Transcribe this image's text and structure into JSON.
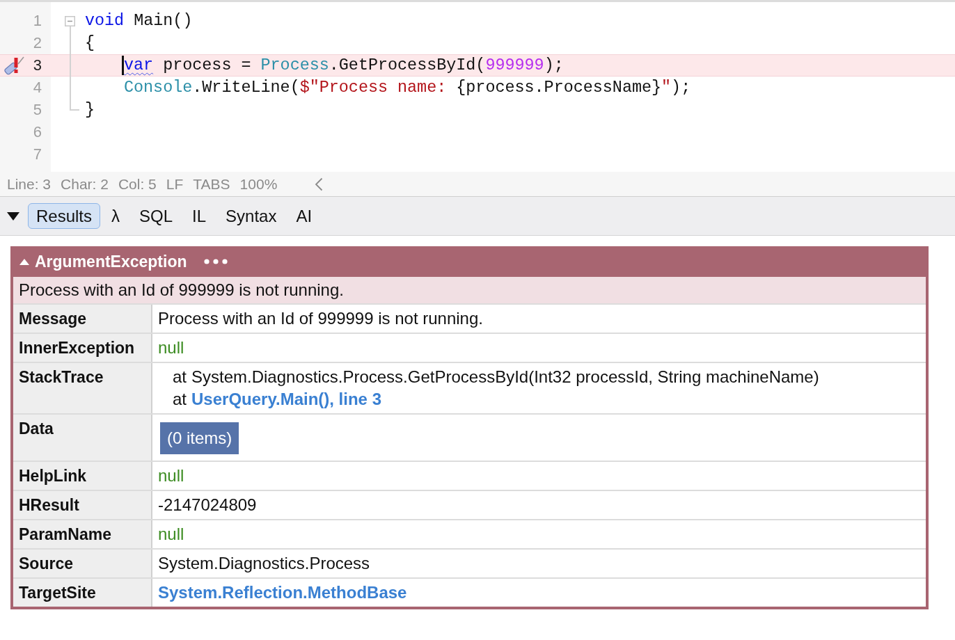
{
  "editor": {
    "fold_expanded": true,
    "lines": [
      {
        "number": "1",
        "current": false,
        "error": false,
        "tokens": [
          {
            "text": "void",
            "kind": "keyword",
            "squiggle": false
          },
          {
            "text": " Main()",
            "kind": "plain",
            "squiggle": false
          }
        ]
      },
      {
        "number": "2",
        "current": false,
        "error": false,
        "tokens": [
          {
            "text": "{",
            "kind": "plain",
            "squiggle": false
          }
        ],
        "children": [
          {
            "number": "3",
            "current": true,
            "error": true,
            "tokens": [
              {
                "text": "var",
                "kind": "keyword",
                "squiggle": true
              },
              {
                "text": " process = ",
                "kind": "plain",
                "squiggle": false
              },
              {
                "text": "Process",
                "kind": "type",
                "squiggle": false
              },
              {
                "text": ".GetProcessById(",
                "kind": "plain",
                "squiggle": false
              },
              {
                "text": "999999",
                "kind": "number",
                "squiggle": false
              },
              {
                "text": ");",
                "kind": "plain",
                "squiggle": false
              }
            ]
          },
          {
            "number": "4",
            "current": false,
            "error": false,
            "tokens": [
              {
                "text": "Console",
                "kind": "type",
                "squiggle": false
              },
              {
                "text": ".WriteLine(",
                "kind": "plain",
                "squiggle": false
              },
              {
                "text": "$\"Process name: ",
                "kind": "string",
                "squiggle": false
              },
              {
                "text": "{process.ProcessName}",
                "kind": "plain",
                "squiggle": false
              },
              {
                "text": "\"",
                "kind": "string",
                "squiggle": false
              },
              {
                "text": ");",
                "kind": "plain",
                "squiggle": false
              }
            ]
          }
        ]
      },
      {
        "number": "5",
        "current": false,
        "error": false,
        "tokens": [
          {
            "text": "}",
            "kind": "plain",
            "squiggle": false
          }
        ]
      },
      {
        "number": "6",
        "current": false,
        "error": false
      },
      {
        "number": "7",
        "current": false,
        "error": false
      }
    ]
  },
  "status_bar": {
    "items": [
      "Line: 3",
      "Char: 2",
      "Col: 5",
      "LF",
      "TABS",
      "100%"
    ]
  },
  "results_tabs": {
    "expanded": true,
    "tabs": [
      {
        "label": "Results",
        "selected": true
      },
      {
        "label": "λ",
        "selected": false
      },
      {
        "label": "SQL",
        "selected": false
      },
      {
        "label": "IL",
        "selected": false
      },
      {
        "label": "Syntax",
        "selected": false
      },
      {
        "label": "AI",
        "selected": false
      }
    ]
  },
  "exception": {
    "type": "ArgumentException",
    "expanded": true,
    "summary": "Process with an Id of 999999 is not running.",
    "properties": [
      {
        "name": "Message",
        "kind": "text",
        "value": "Process with an Id of 999999 is not running."
      },
      {
        "name": "InnerException",
        "kind": "null",
        "value": "null"
      },
      {
        "name": "StackTrace",
        "kind": "stack",
        "frames": [
          {
            "prefix": "at",
            "kind": "text",
            "text": "System.Diagnostics.Process.GetProcessById(Int32 processId, String machineName)"
          },
          {
            "prefix": "at",
            "kind": "link",
            "text": "UserQuery.Main(), line 3"
          }
        ]
      },
      {
        "name": "Data",
        "kind": "button",
        "value": "(0 items)"
      },
      {
        "name": "HelpLink",
        "kind": "null",
        "value": "null"
      },
      {
        "name": "HResult",
        "kind": "text",
        "value": "-2147024809"
      },
      {
        "name": "ParamName",
        "kind": "null",
        "value": "null"
      },
      {
        "name": "Source",
        "kind": "text",
        "value": "System.Diagnostics.Process"
      },
      {
        "name": "TargetSite",
        "kind": "link",
        "value": "System.Reflection.MethodBase"
      }
    ]
  }
}
